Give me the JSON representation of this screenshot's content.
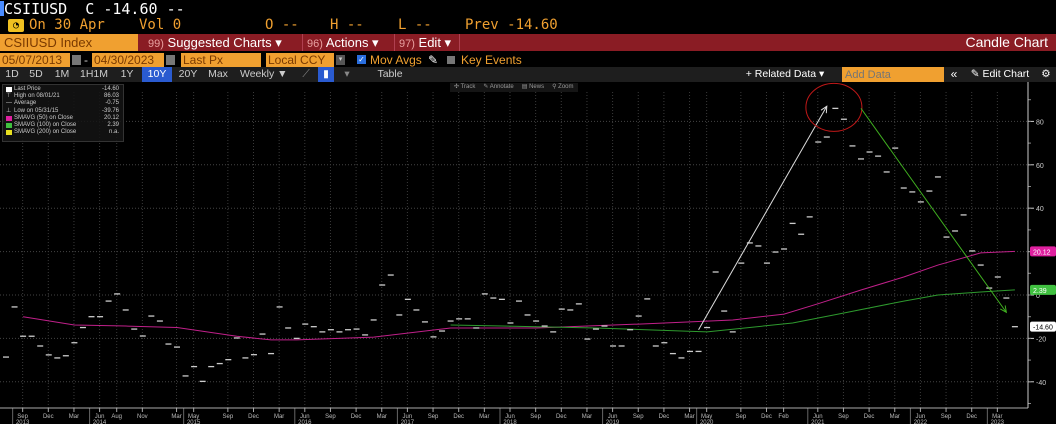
{
  "header": {
    "ticker": "CSIIUSD",
    "close_label": "C",
    "close": "-14.60",
    "close_suffix": "--",
    "date_label": "On 30 Apr",
    "vol": "Vol 0",
    "open": "O --",
    "high": "H --",
    "low": "L --",
    "prev": "Prev -14.60"
  },
  "menu": {
    "security": "CSIIUSD Index",
    "suggested_num": "99)",
    "suggested": "Suggested Charts ▾",
    "actions_num": "96)",
    "actions": "Actions ▾",
    "edit_num": "97)",
    "edit": "Edit ▾",
    "chart_type": "Candle Chart"
  },
  "settings": {
    "start_date": "05/07/2013",
    "dash": "-",
    "end_date": "04/30/2023",
    "field": "Last Px",
    "currency": "Local CCY",
    "mov_avgs": "Mov Avgs",
    "mov_avgs_checked": true,
    "key_events": "Key Events",
    "key_events_checked": false
  },
  "toolbar": {
    "periods": [
      "1D",
      "5D",
      "1M",
      "1H1M",
      "1Y",
      "10Y",
      "20Y",
      "Max"
    ],
    "selected_period": "10Y",
    "frequency": "Weekly ▼",
    "table": "Table",
    "related": "+ Related Data ▾",
    "add_data_placeholder": "Add Data",
    "collapse": "«",
    "edit_chart": "✎ Edit Chart",
    "settings_icon": "gear-icon"
  },
  "chart_tools": [
    "✣ Track",
    "✎ Annotate",
    "▤ News",
    "⚲ Zoom"
  ],
  "legend": [
    {
      "label": "Last Price",
      "value": "-14.60",
      "color": "#ffffff"
    },
    {
      "label": "High on 08/01/21",
      "value": "86.03",
      "color": ""
    },
    {
      "label": "Average",
      "value": "-0.75",
      "color": ""
    },
    {
      "label": "Low on 05/31/15",
      "value": "-39.76",
      "color": ""
    },
    {
      "label": "SMAVG (50)  on Close",
      "value": "20.12",
      "color": "#e020a0"
    },
    {
      "label": "SMAVG (100)  on Close",
      "value": "2.39",
      "color": "#40c040"
    },
    {
      "label": "SMAVG (200)  on Close",
      "value": "n.a.",
      "color": "#e8e020"
    }
  ],
  "chart_data": {
    "type": "candlestick",
    "ylim": [
      -50,
      95
    ],
    "yticks": [
      80,
      60,
      40,
      20,
      0,
      -20,
      -40
    ],
    "grid": true,
    "series": [
      {
        "name": "Last Price",
        "color": "#cccccc",
        "x": [
          "2013-06",
          "2013-07",
          "2013-08",
          "2013-09",
          "2013-10",
          "2013-11",
          "2013-12",
          "2014-01",
          "2014-02",
          "2014-03",
          "2014-04",
          "2014-05",
          "2014-06",
          "2014-07",
          "2014-08",
          "2014-09",
          "2014-10",
          "2014-11",
          "2014-12",
          "2015-01",
          "2015-02",
          "2015-03",
          "2015-04",
          "2015-05",
          "2015-06",
          "2015-07",
          "2015-08",
          "2015-09",
          "2015-10",
          "2015-11",
          "2015-12",
          "2016-01",
          "2016-02",
          "2016-03",
          "2016-04",
          "2016-05",
          "2016-06",
          "2016-07",
          "2016-08",
          "2016-09",
          "2016-10",
          "2016-11",
          "2016-12",
          "2017-01",
          "2017-02",
          "2017-03",
          "2017-04",
          "2017-05",
          "2017-06",
          "2017-07",
          "2017-08",
          "2017-09",
          "2017-10",
          "2017-11",
          "2017-12",
          "2018-01",
          "2018-02",
          "2018-03",
          "2018-04",
          "2018-05",
          "2018-06",
          "2018-07",
          "2018-08",
          "2018-09",
          "2018-10",
          "2018-11",
          "2018-12",
          "2019-01",
          "2019-02",
          "2019-03",
          "2019-04",
          "2019-05",
          "2019-06",
          "2019-07",
          "2019-08",
          "2019-09",
          "2019-10",
          "2019-11",
          "2019-12",
          "2020-01",
          "2020-02",
          "2020-03",
          "2020-04",
          "2020-05",
          "2020-06",
          "2020-07",
          "2020-08",
          "2020-09",
          "2020-10",
          "2020-11",
          "2020-12",
          "2021-01",
          "2021-02",
          "2021-03",
          "2021-04",
          "2021-05",
          "2021-06",
          "2021-07",
          "2021-08",
          "2021-09",
          "2021-10",
          "2021-11",
          "2021-12",
          "2022-01",
          "2022-02",
          "2022-03",
          "2022-04",
          "2022-05",
          "2022-06",
          "2022-07",
          "2022-08",
          "2022-09",
          "2022-10",
          "2022-11",
          "2022-12",
          "2023-01",
          "2023-02",
          "2023-03",
          "2023-04"
        ],
        "y": [
          -28.6,
          -5.5,
          -19,
          -19,
          -23.5,
          -27.6,
          -29,
          -28,
          -22,
          -15,
          -10,
          -10,
          -2.8,
          0.5,
          -6.9,
          -15.7,
          -18.9,
          -9.7,
          -12,
          -22.6,
          -24,
          -37.3,
          -33,
          -39.8,
          -33,
          -31.6,
          -29.8,
          -19.8,
          -29,
          -27.5,
          -18,
          -27,
          -5.5,
          -15.2,
          -20,
          -13.4,
          -14.6,
          -17,
          -16,
          -17,
          -16,
          -15.7,
          -18.4,
          -11.5,
          4.6,
          9.2,
          -9.2,
          -2,
          -6.9,
          -12.4,
          -19.3,
          -16.6,
          -12,
          -11,
          -11,
          -15.2,
          0.5,
          -1.4,
          -2,
          -12.9,
          -2.8,
          -9.2,
          -12,
          -14.3,
          -17,
          -6.5,
          -6.9,
          -4.1,
          -20.3,
          -15.7,
          -14.3,
          -23.5,
          -23.5,
          -16,
          -9.7,
          -1.8,
          -23.5,
          -22,
          -27,
          -29,
          -26,
          -26,
          -15,
          10.6,
          -7.4,
          -17,
          14.7,
          24,
          22.6,
          14.7,
          19.8,
          21.2,
          33,
          28,
          36,
          70.5,
          72.8,
          86,
          81,
          68.7,
          62.7,
          65.9,
          64,
          56.7,
          67.7,
          49.3,
          47.5,
          42.9,
          47.9,
          54.4,
          26.7,
          29.5,
          36.9,
          20.3,
          13.8,
          3.2,
          8.3,
          -1.4,
          -14.6
        ]
      },
      {
        "name": "SMAVG (50)",
        "color": "#c0208a",
        "x": [
          "2013-08",
          "2014-02",
          "2014-08",
          "2015-02",
          "2015-09",
          "2016-01",
          "2016-04",
          "2017-01",
          "2017-10",
          "2018-08",
          "2019-08",
          "2020-07",
          "2021-01",
          "2021-05",
          "2021-10",
          "2022-03",
          "2022-07",
          "2022-12",
          "2023-04"
        ],
        "y": [
          -10,
          -13.8,
          -14.3,
          -15,
          -19,
          -20.7,
          -20.7,
          -19.4,
          -15.2,
          -15.2,
          -13.4,
          -11.5,
          -8.8,
          -4,
          2.3,
          8.3,
          13.8,
          19.4,
          20.12
        ]
      },
      {
        "name": "SMAVG (100)",
        "color": "#2e9a2e",
        "x": [
          "2017-10",
          "2019-03",
          "2020-01",
          "2020-04",
          "2021-02",
          "2021-08",
          "2022-03",
          "2022-07",
          "2022-12",
          "2023-04"
        ],
        "y": [
          -13.8,
          -15.2,
          -16.6,
          -17,
          -12.9,
          -8.3,
          -2.8,
          0,
          1.4,
          2.39
        ]
      }
    ],
    "last_labels": [
      {
        "value": "20.12",
        "color": "#e020a0"
      },
      {
        "value": "2.39",
        "color": "#40c040"
      },
      {
        "value": "-14.60",
        "color": "#ffffff"
      }
    ],
    "xticks": [
      {
        "d": "2013-09",
        "m": "Sep",
        "y": "2013"
      },
      {
        "d": "2013-12",
        "m": "Dec",
        "y": ""
      },
      {
        "d": "2014-03",
        "m": "Mar",
        "y": ""
      },
      {
        "d": "2014-06",
        "m": "Jun",
        "y": "2014"
      },
      {
        "d": "2014-08",
        "m": "Aug",
        "y": ""
      },
      {
        "d": "2014-11",
        "m": "Nov",
        "y": ""
      },
      {
        "d": "2015-03",
        "m": "Mar",
        "y": ""
      },
      {
        "d": "2015-05",
        "m": "May",
        "y": "2015"
      },
      {
        "d": "2015-09",
        "m": "Sep",
        "y": ""
      },
      {
        "d": "2015-12",
        "m": "Dec",
        "y": ""
      },
      {
        "d": "2016-03",
        "m": "Mar",
        "y": ""
      },
      {
        "d": "2016-06",
        "m": "Jun",
        "y": "2016"
      },
      {
        "d": "2016-09",
        "m": "Sep",
        "y": ""
      },
      {
        "d": "2016-12",
        "m": "Dec",
        "y": ""
      },
      {
        "d": "2017-03",
        "m": "Mar",
        "y": ""
      },
      {
        "d": "2017-06",
        "m": "Jun",
        "y": "2017"
      },
      {
        "d": "2017-09",
        "m": "Sep",
        "y": ""
      },
      {
        "d": "2017-12",
        "m": "Dec",
        "y": ""
      },
      {
        "d": "2018-03",
        "m": "Mar",
        "y": ""
      },
      {
        "d": "2018-06",
        "m": "Jun",
        "y": "2018"
      },
      {
        "d": "2018-09",
        "m": "Sep",
        "y": ""
      },
      {
        "d": "2018-12",
        "m": "Dec",
        "y": ""
      },
      {
        "d": "2019-03",
        "m": "Mar",
        "y": ""
      },
      {
        "d": "2019-06",
        "m": "Jun",
        "y": "2019"
      },
      {
        "d": "2019-09",
        "m": "Sep",
        "y": ""
      },
      {
        "d": "2019-12",
        "m": "Dec",
        "y": ""
      },
      {
        "d": "2020-03",
        "m": "Mar",
        "y": ""
      },
      {
        "d": "2020-05",
        "m": "May",
        "y": "2020"
      },
      {
        "d": "2020-09",
        "m": "Sep",
        "y": ""
      },
      {
        "d": "2020-12",
        "m": "Dec",
        "y": ""
      },
      {
        "d": "2021-02",
        "m": "Feb",
        "y": ""
      },
      {
        "d": "2021-06",
        "m": "Jun",
        "y": "2021"
      },
      {
        "d": "2021-09",
        "m": "Sep",
        "y": ""
      },
      {
        "d": "2021-12",
        "m": "Dec",
        "y": ""
      },
      {
        "d": "2022-03",
        "m": "Mar",
        "y": ""
      },
      {
        "d": "2022-06",
        "m": "Jun",
        "y": "2022"
      },
      {
        "d": "2022-09",
        "m": "Sep",
        "y": ""
      },
      {
        "d": "2022-12",
        "m": "Dec",
        "y": ""
      },
      {
        "d": "2023-03",
        "m": "Mar",
        "y": "2023"
      }
    ],
    "annotations": [
      {
        "type": "arrow",
        "color": "#dddddd",
        "from": [
          "2020-03",
          -16
        ],
        "to": [
          "2021-06",
          87
        ]
      },
      {
        "type": "ellipse",
        "color": "#c01818",
        "center": [
          "2021-08",
          86
        ]
      },
      {
        "type": "arrow",
        "color": "#40b020",
        "from": [
          "2021-10",
          86
        ],
        "to": [
          "2023-03",
          -8
        ]
      }
    ]
  }
}
